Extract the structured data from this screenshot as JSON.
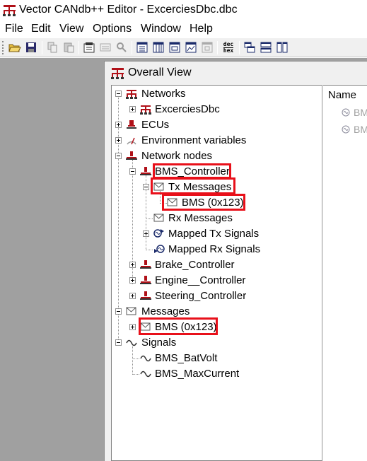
{
  "window": {
    "title": "Vector CANdb++ Editor - ExcerciesDbc.dbc"
  },
  "menu": [
    "File",
    "Edit",
    "View",
    "Options",
    "Window",
    "Help"
  ],
  "toolbar": {
    "buttons": [
      "open-icon",
      "save-icon",
      "copy-icon",
      "paste-icon",
      "properties-icon",
      "view-icon",
      "find-icon",
      "overall-view-icon",
      "table-view-icon",
      "signal-view-icon",
      "graph-view-icon",
      "extra-view-icon",
      "dec-hex-icon",
      "cascade-icon",
      "tile-horizontal-icon",
      "tile-vertical-icon"
    ],
    "dec_hex": {
      "top": "dec",
      "bottom": "hex"
    }
  },
  "child_window": {
    "title": "Overall View"
  },
  "tree": {
    "networks": "Networks",
    "network_db": "ExcerciesDbc",
    "ecus": "ECUs",
    "env_vars": "Environment variables",
    "network_nodes": "Network nodes",
    "bms_controller": "BMS_Controller",
    "tx_messages": "Tx Messages",
    "tx_bms": "BMS (0x123)",
    "rx_messages": "Rx Messages",
    "mapped_tx": "Mapped Tx Signals",
    "mapped_rx": "Mapped Rx Signals",
    "brake_controller": "Brake_Controller",
    "engine_controller": "Engine__Controller",
    "steering_controller": "Steering_Controller",
    "messages": "Messages",
    "msg_bms": "BMS (0x123)",
    "signals": "Signals",
    "sig_batvolt": "BMS_BatVolt",
    "sig_maxcurrent": "BMS_MaxCurrent"
  },
  "list": {
    "header": "Name",
    "rows": [
      "BMS",
      "BMS"
    ]
  },
  "colors": {
    "highlight": "#e8101a",
    "workspace": "#a0a0a0",
    "node_icon": "#b01018"
  }
}
